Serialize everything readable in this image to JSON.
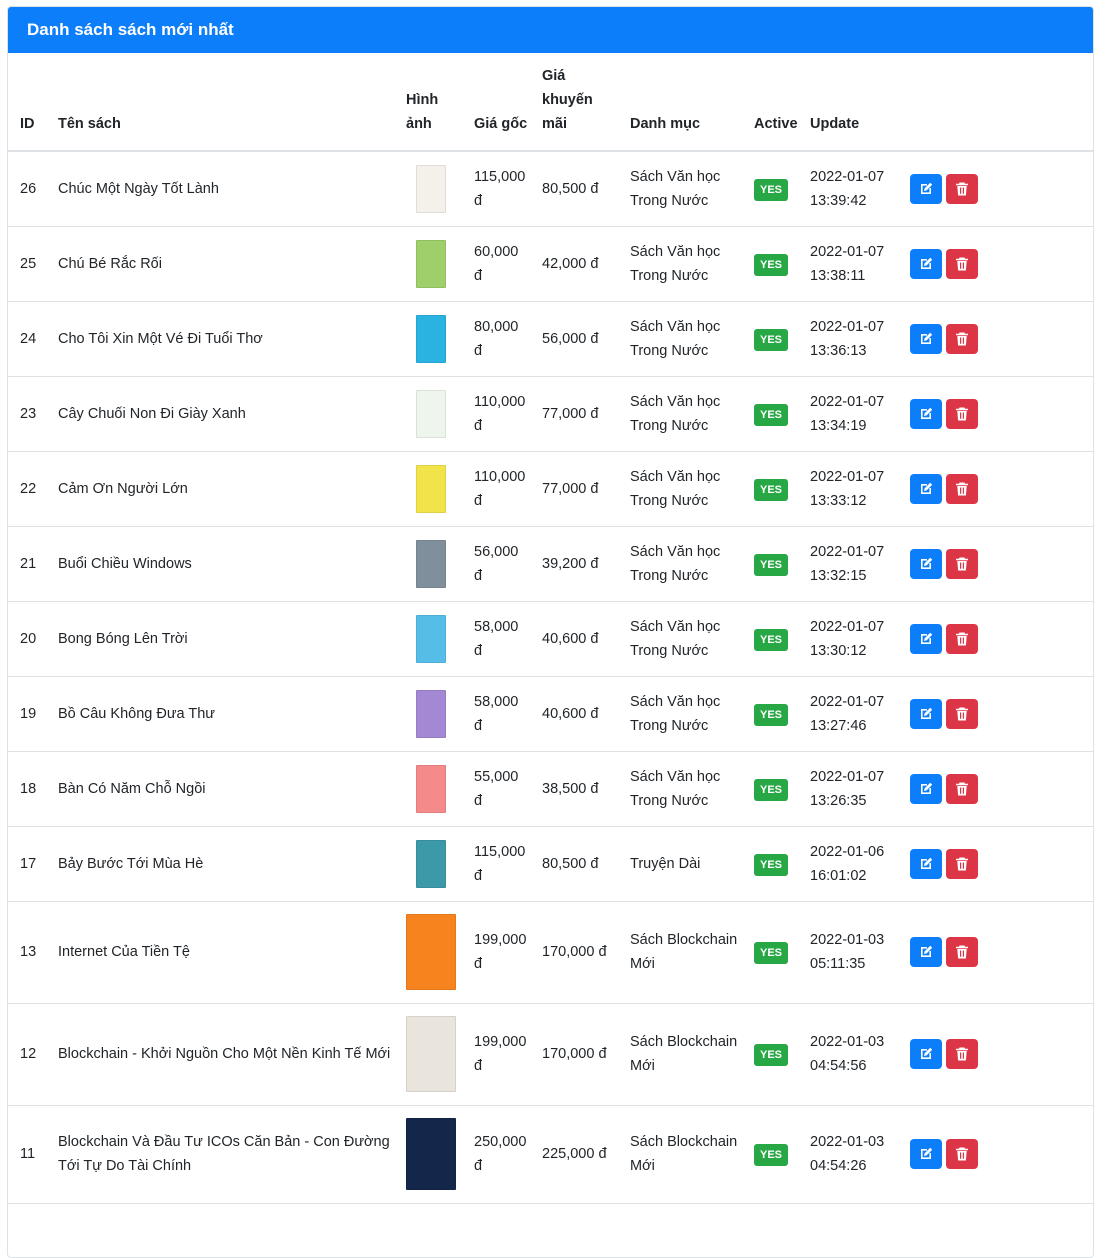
{
  "card": {
    "title": "Danh sách sách mới nhất"
  },
  "columns": {
    "id": "ID",
    "name": "Tên sách",
    "image_1": "Hình",
    "image_2": "ảnh",
    "price_1": "Giá gốc",
    "promo_1": "Giá",
    "promo_2": "khuyến",
    "promo_3": "mãi",
    "category": "Danh mục",
    "active": "Active",
    "update": "Update"
  },
  "rows": [
    {
      "id": "26",
      "name": "Chúc Một Ngày Tốt Lành",
      "price_1": "115,000",
      "price_2": "đ",
      "promo": "80,500 đ",
      "cat_1": "Sách Văn học",
      "cat_2": "Trong Nước",
      "active": "YES",
      "date": "2022-01-07",
      "time": "13:39:42"
    },
    {
      "id": "25",
      "name": "Chú Bé Rắc Rối",
      "price_1": "60,000 đ",
      "price_2": "",
      "promo": "42,000 đ",
      "cat_1": "Sách Văn học",
      "cat_2": "Trong Nước",
      "active": "YES",
      "date": "2022-01-07",
      "time": "13:38:11"
    },
    {
      "id": "24",
      "name": "Cho Tôi Xin Một Vé Đi Tuổi Thơ",
      "price_1": "80,000 đ",
      "price_2": "",
      "promo": "56,000 đ",
      "cat_1": "Sách Văn học",
      "cat_2": "Trong Nước",
      "active": "YES",
      "date": "2022-01-07",
      "time": "13:36:13"
    },
    {
      "id": "23",
      "name": "Cây Chuối Non Đi Giày Xanh",
      "price_1": "110,000",
      "price_2": "đ",
      "promo": "77,000 đ",
      "cat_1": "Sách Văn học",
      "cat_2": "Trong Nước",
      "active": "YES",
      "date": "2022-01-07",
      "time": "13:34:19"
    },
    {
      "id": "22",
      "name": "Cảm Ơn Người Lớn",
      "price_1": "110,000",
      "price_2": "đ",
      "promo": "77,000 đ",
      "cat_1": "Sách Văn học",
      "cat_2": "Trong Nước",
      "active": "YES",
      "date": "2022-01-07",
      "time": "13:33:12"
    },
    {
      "id": "21",
      "name": "Buổi Chiều Windows",
      "price_1": "56,000 đ",
      "price_2": "",
      "promo": "39,200 đ",
      "cat_1": "Sách Văn học",
      "cat_2": "Trong Nước",
      "active": "YES",
      "date": "2022-01-07",
      "time": "13:32:15"
    },
    {
      "id": "20",
      "name": "Bong Bóng Lên Trời",
      "price_1": "58,000 đ",
      "price_2": "",
      "promo": "40,600 đ",
      "cat_1": "Sách Văn học",
      "cat_2": "Trong Nước",
      "active": "YES",
      "date": "2022-01-07",
      "time": "13:30:12"
    },
    {
      "id": "19",
      "name": "Bồ Câu Không Đưa Thư",
      "price_1": "58,000 đ",
      "price_2": "",
      "promo": "40,600 đ",
      "cat_1": "Sách Văn học",
      "cat_2": "Trong Nước",
      "active": "YES",
      "date": "2022-01-07",
      "time": "13:27:46"
    },
    {
      "id": "18",
      "name": "Bàn Có Năm Chỗ Ngồi",
      "price_1": "55,000 đ",
      "price_2": "",
      "promo": "38,500 đ",
      "cat_1": "Sách Văn học",
      "cat_2": "Trong Nước",
      "active": "YES",
      "date": "2022-01-07",
      "time": "13:26:35"
    },
    {
      "id": "17",
      "name": "Bảy Bước Tới Mùa Hè",
      "price_1": "115,000",
      "price_2": "đ",
      "promo": "80,500 đ",
      "cat_1": "Truyện Dài",
      "cat_2": "",
      "active": "YES",
      "date": "2022-01-06",
      "time": "16:01:02"
    },
    {
      "id": "13",
      "name": "Internet Của Tiền Tệ",
      "price_1": "199,000",
      "price_2": "đ",
      "promo": "170,000 đ",
      "cat_1": "Sách Blockchain",
      "cat_2": "Mới",
      "active": "YES",
      "date": "2022-01-03",
      "time": "05:11:35"
    },
    {
      "id": "12",
      "name": "Blockchain - Khởi Nguồn Cho Một Nền Kinh Tế Mới",
      "price_1": "199,000",
      "price_2": "đ",
      "promo": "170,000 đ",
      "cat_1": "Sách Blockchain",
      "cat_2": "Mới",
      "active": "YES",
      "date": "2022-01-03",
      "time": "04:54:56"
    },
    {
      "id": "11",
      "name": "Blockchain Và Đầu Tư ICOs Căn Bản - Con Đường Tới Tự Do Tài Chính",
      "price_1": "250,000",
      "price_2": "đ",
      "promo": "225,000 đ",
      "cat_1": "Sách Blockchain",
      "cat_2": "Mới",
      "active": "YES",
      "date": "2022-01-03",
      "time": "04:54:26"
    }
  ],
  "covers": [
    {
      "icon": "book-cover-white",
      "color": "#f4f0ea"
    },
    {
      "icon": "book-cover-green",
      "color": "#9fcf6a"
    },
    {
      "icon": "book-cover-cyan",
      "color": "#2ab3e0"
    },
    {
      "icon": "book-cover-white",
      "color": "#eef5ec"
    },
    {
      "icon": "book-cover-yellow",
      "color": "#f3e34a"
    },
    {
      "icon": "book-cover-gray",
      "color": "#7f8f9c"
    },
    {
      "icon": "book-cover-lightblue",
      "color": "#56bde8"
    },
    {
      "icon": "book-cover-purple",
      "color": "#a488d4"
    },
    {
      "icon": "book-cover-pink",
      "color": "#f48a8a"
    },
    {
      "icon": "book-cover-teal",
      "color": "#3c9aa8"
    },
    {
      "icon": "book-cover-orange",
      "color": "#f7831f"
    },
    {
      "icon": "book-cover-bull",
      "color": "#e9e4dc"
    },
    {
      "icon": "book-cover-navy",
      "color": "#14274a"
    }
  ],
  "colors": {
    "primary": "#0d7ef9",
    "danger": "#dc3545",
    "success": "#28a745"
  }
}
